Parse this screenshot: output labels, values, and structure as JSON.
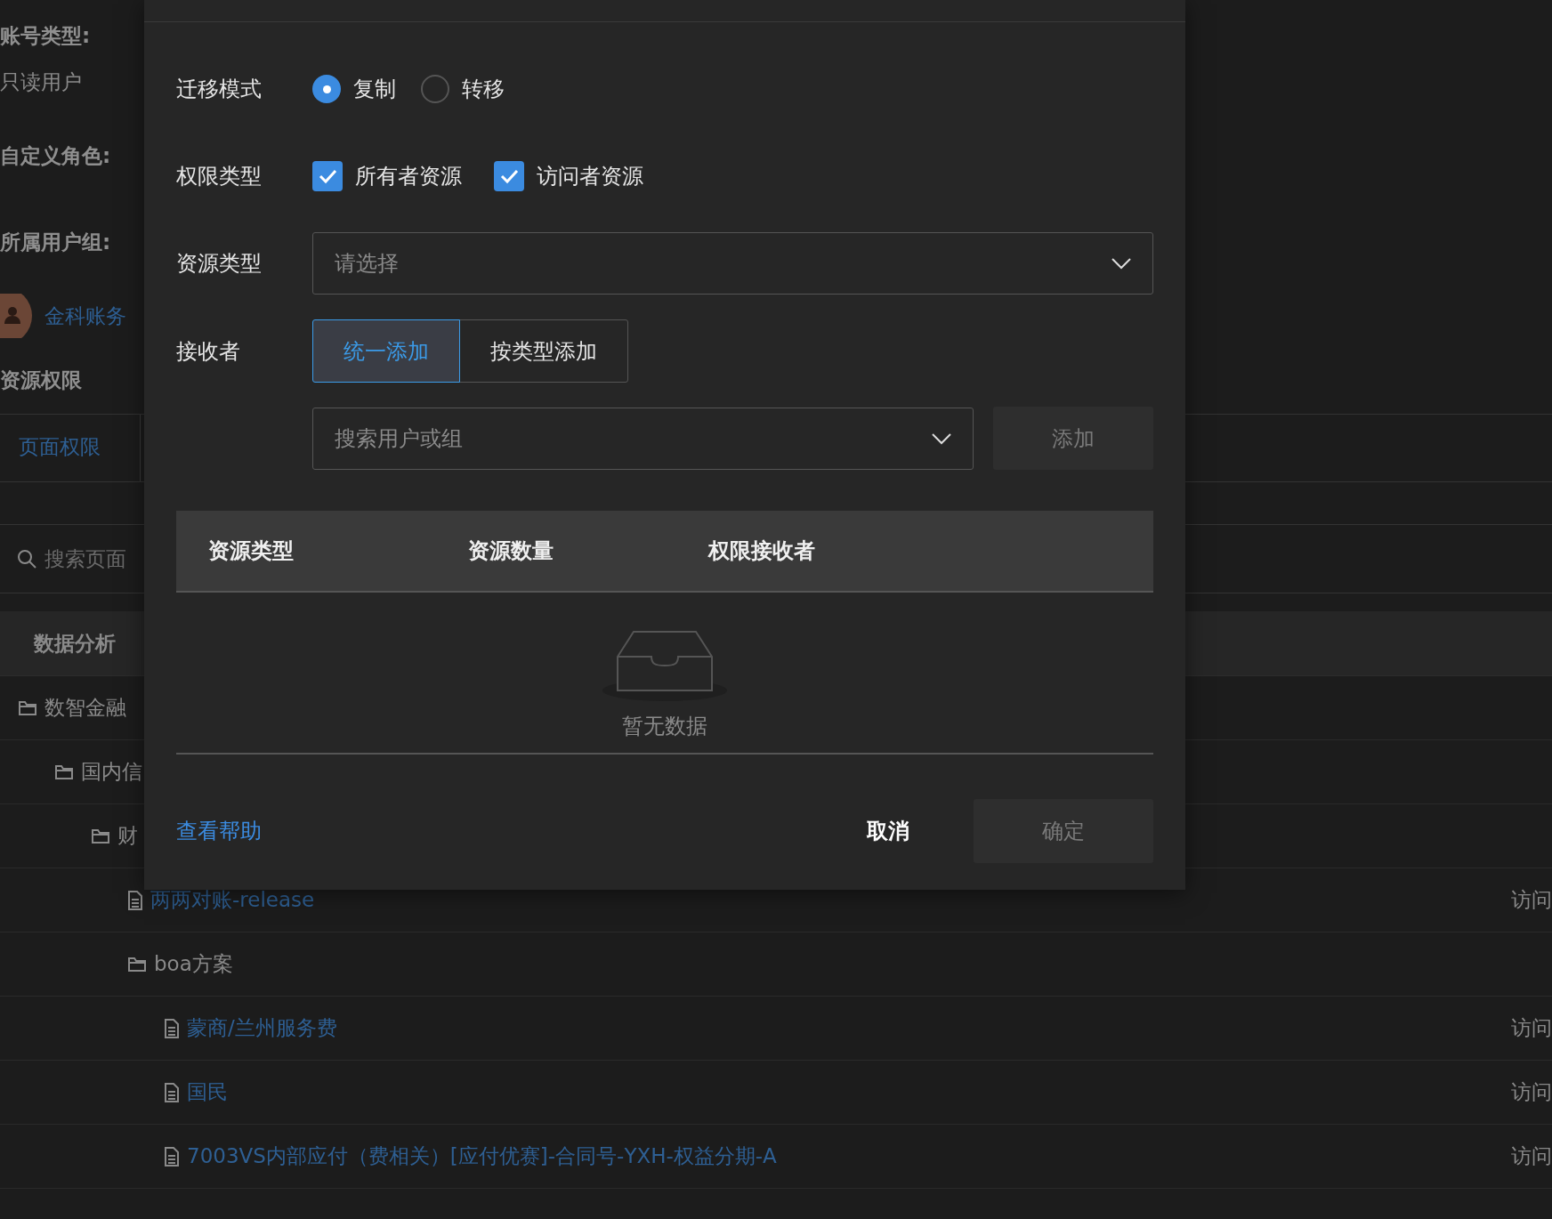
{
  "background": {
    "account_type_label": "账号类型:",
    "account_type": "只读用户",
    "custom_role_label": "自定义角色:",
    "group_label": "所属用户组:",
    "group": "金科账务",
    "section_title": "资源权限",
    "tabs": [
      {
        "label": "页面权限",
        "selected": true
      }
    ],
    "search": {
      "placeholder": "搜索页面"
    },
    "tree_header": "数据分析",
    "tree": [
      {
        "kind": "folder",
        "name": "数智金融",
        "children": [
          {
            "kind": "folder",
            "name": "国内信",
            "children": [
              {
                "kind": "folder",
                "name": "财",
                "children": [
                  {
                    "kind": "file",
                    "name": "两两对账-release",
                    "access": "访问"
                  },
                  {
                    "kind": "folder",
                    "name": "boa方案",
                    "children": [
                      {
                        "kind": "file",
                        "name": "蒙商/兰州服务费",
                        "access": "访问"
                      },
                      {
                        "kind": "file",
                        "name": "国民",
                        "access": "访问"
                      },
                      {
                        "kind": "file",
                        "name": "7003VS内部应付（费相关）[应付优赛]-合同号-YXH-权益分期-A",
                        "access": "访问"
                      }
                    ]
                  }
                ]
              }
            ]
          }
        ]
      }
    ]
  },
  "dialog": {
    "mode_label": "迁移模式",
    "modes": [
      {
        "label": "复制",
        "selected": true
      },
      {
        "label": "转移",
        "selected": false
      }
    ],
    "permission_label": "权限类型",
    "permissions": [
      {
        "label": "所有者资源",
        "checked": true
      },
      {
        "label": "访问者资源",
        "checked": true
      }
    ],
    "resource_type_label": "资源类型",
    "resource_type": {
      "placeholder": "请选择"
    },
    "receiver_label": "接收者",
    "receiver_modes": [
      {
        "label": "统一添加",
        "selected": true
      },
      {
        "label": "按类型添加",
        "selected": false
      }
    ],
    "receiver_search": {
      "placeholder": "搜索用户或组"
    },
    "add_button": {
      "label": "添加",
      "disabled": true
    },
    "table": {
      "columns": [
        "资源类型",
        "资源数量",
        "权限接收者"
      ],
      "empty_text": "暂无数据"
    },
    "help_link": "查看帮助",
    "cancel_button": "取消",
    "ok_button": {
      "label": "确定",
      "disabled": true
    }
  }
}
